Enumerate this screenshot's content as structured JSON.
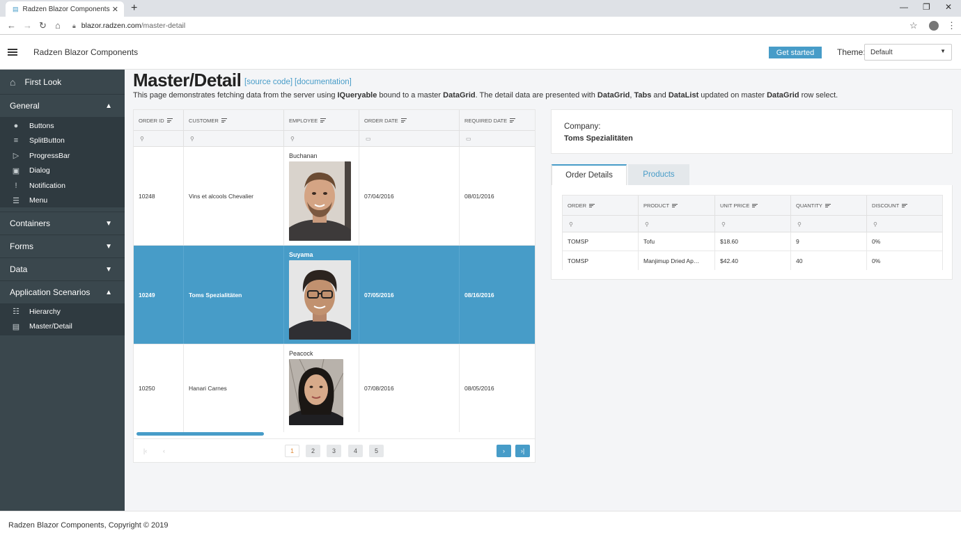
{
  "browser": {
    "tab_title": "Radzen Blazor Components",
    "url_host": "blazor.radzen.com",
    "url_path": "/master-detail"
  },
  "header": {
    "brand": "Radzen Blazor Components",
    "get_started": "Get started",
    "theme_label": "Theme:",
    "theme_value": "Default"
  },
  "sidebar": {
    "first_look": "First Look",
    "general": {
      "label": "General",
      "items": [
        {
          "label": "Buttons",
          "icon": "account-circle-icon"
        },
        {
          "label": "SplitButton",
          "icon": "split-list-icon"
        },
        {
          "label": "ProgressBar",
          "icon": "label-icon"
        },
        {
          "label": "Dialog",
          "icon": "image-icon"
        },
        {
          "label": "Notification",
          "icon": "announcement-icon"
        },
        {
          "label": "Menu",
          "icon": "menu-icon"
        }
      ]
    },
    "containers": "Containers",
    "forms": "Forms",
    "data": "Data",
    "app_scenarios": {
      "label": "Application Scenarios",
      "items": [
        {
          "label": "Hierarchy",
          "icon": "hierarchy-icon"
        },
        {
          "label": "Master/Detail",
          "icon": "master-detail-icon"
        }
      ]
    }
  },
  "page": {
    "title": "Master/Detail",
    "source_code": "[source code]",
    "documentation": "[documentation]",
    "desc_1": "This page demonstrates fetching data from the server using ",
    "desc_b1": "IQueryable",
    "desc_2": " bound to a master ",
    "desc_b2": "DataGrid",
    "desc_3": ". The detail data are presented with ",
    "desc_b3": "DataGrid",
    "desc_4": ", ",
    "desc_b4": "Tabs",
    "desc_5": " and ",
    "desc_b5": "DataList",
    "desc_6": " updated on master ",
    "desc_b6": "DataGrid",
    "desc_7": " row select."
  },
  "master_grid": {
    "columns": [
      "ORDER ID",
      "CUSTOMER",
      "EMPLOYEE",
      "ORDER DATE",
      "REQUIRED DATE"
    ],
    "rows": [
      {
        "order_id": "10248",
        "customer": "Vins et alcools Chevalier",
        "employee": "Buchanan",
        "order_date": "07/04/2016",
        "required_date": "08/01/2016",
        "selected": false
      },
      {
        "order_id": "10249",
        "customer": "Toms Spezialitäten",
        "employee": "Suyama",
        "order_date": "07/05/2016",
        "required_date": "08/16/2016",
        "selected": true
      },
      {
        "order_id": "10250",
        "customer": "Hanari Carnes",
        "employee": "Peacock",
        "order_date": "07/08/2016",
        "required_date": "08/05/2016",
        "selected": false
      }
    ],
    "pages": [
      "1",
      "2",
      "3",
      "4",
      "5"
    ],
    "current_page": "1"
  },
  "company": {
    "label": "Company:",
    "value": "Toms Spezialitäten"
  },
  "detail_tabs": {
    "tab1": "Order Details",
    "tab2": "Products",
    "columns": [
      "ORDER",
      "PRODUCT",
      "UNIT PRICE",
      "QUANTITY",
      "DISCOUNT"
    ],
    "rows": [
      {
        "order": "TOMSP",
        "product": "Tofu",
        "unit_price": "$18.60",
        "quantity": "9",
        "discount": "0%"
      },
      {
        "order": "TOMSP",
        "product": "Manjimup Dried Ap…",
        "unit_price": "$42.40",
        "quantity": "40",
        "discount": "0%"
      }
    ]
  },
  "footer": {
    "text": "Radzen Blazor Components, Copyright © 2019"
  },
  "colors": {
    "accent": "#479cc8",
    "sidebar": "#3a474d",
    "sidebar_sub": "#2f3a40"
  }
}
